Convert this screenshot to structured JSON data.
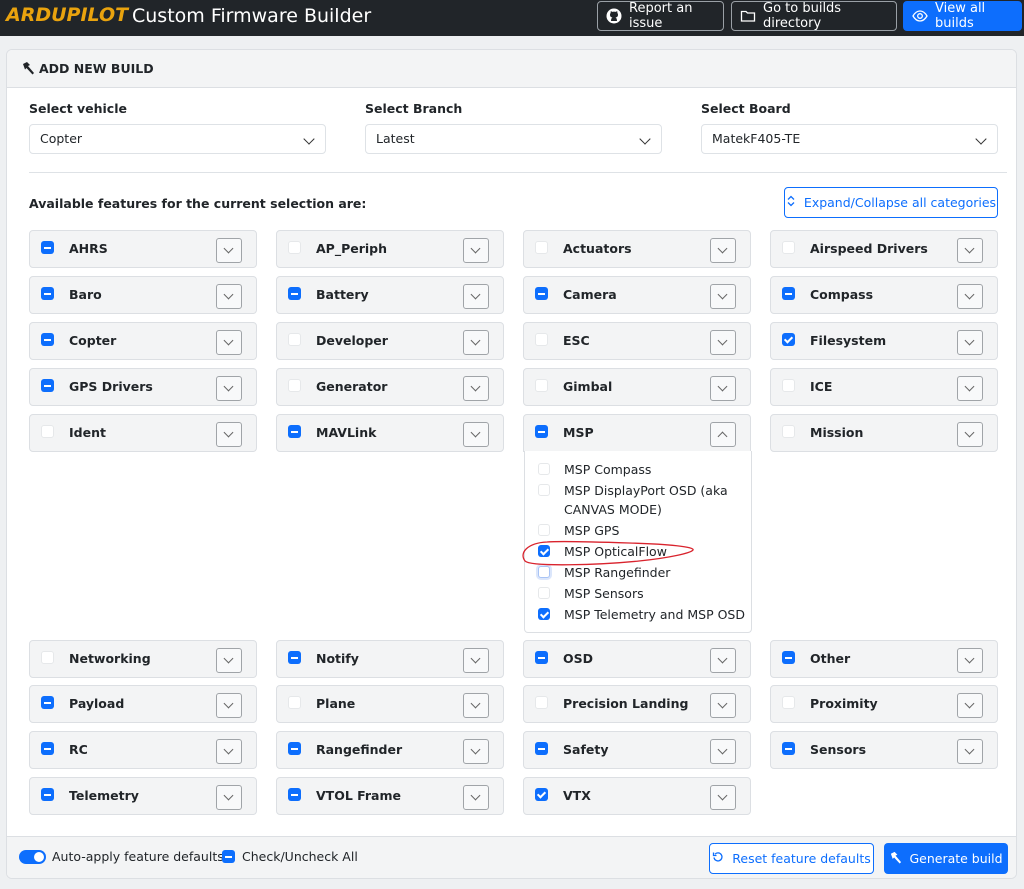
{
  "header": {
    "logo": "ARDUPILOT",
    "title": "Custom Firmware Builder",
    "buttons": {
      "report": "Report an issue",
      "builds_dir": "Go to builds directory",
      "view_all": "View all builds"
    }
  },
  "card": {
    "title": "ADD NEW BUILD",
    "vehicle": {
      "label": "Select vehicle",
      "value": "Copter"
    },
    "branch": {
      "label": "Select Branch",
      "value": "Latest"
    },
    "board": {
      "label": "Select Board",
      "value": "MatekF405-TE"
    },
    "available_text": "Available features for the current selection are:",
    "expand_label": "Expand/Collapse all categories"
  },
  "categories": [
    {
      "name": "AHRS",
      "state": "indeterminate"
    },
    {
      "name": "AP_Periph",
      "state": "off"
    },
    {
      "name": "Actuators",
      "state": "off"
    },
    {
      "name": "Airspeed Drivers",
      "state": "off"
    },
    {
      "name": "Baro",
      "state": "indeterminate"
    },
    {
      "name": "Battery",
      "state": "indeterminate"
    },
    {
      "name": "Camera",
      "state": "indeterminate"
    },
    {
      "name": "Compass",
      "state": "indeterminate"
    },
    {
      "name": "Copter",
      "state": "indeterminate"
    },
    {
      "name": "Developer",
      "state": "off"
    },
    {
      "name": "ESC",
      "state": "off"
    },
    {
      "name": "Filesystem",
      "state": "checked"
    },
    {
      "name": "GPS Drivers",
      "state": "indeterminate"
    },
    {
      "name": "Generator",
      "state": "off"
    },
    {
      "name": "Gimbal",
      "state": "off"
    },
    {
      "name": "ICE",
      "state": "off"
    },
    {
      "name": "Ident",
      "state": "off"
    },
    {
      "name": "MAVLink",
      "state": "indeterminate"
    },
    {
      "name": "MSP",
      "state": "indeterminate"
    },
    {
      "name": "Mission",
      "state": "off"
    },
    {
      "name": "Networking",
      "state": "off"
    },
    {
      "name": "Notify",
      "state": "indeterminate"
    },
    {
      "name": "OSD",
      "state": "indeterminate"
    },
    {
      "name": "Other",
      "state": "indeterminate"
    },
    {
      "name": "Payload",
      "state": "indeterminate"
    },
    {
      "name": "Plane",
      "state": "off"
    },
    {
      "name": "Precision Landing",
      "state": "off"
    },
    {
      "name": "Proximity",
      "state": "off"
    },
    {
      "name": "RC",
      "state": "indeterminate"
    },
    {
      "name": "Rangefinder",
      "state": "indeterminate"
    },
    {
      "name": "Safety",
      "state": "indeterminate"
    },
    {
      "name": "Sensors",
      "state": "indeterminate"
    },
    {
      "name": "Telemetry",
      "state": "indeterminate"
    },
    {
      "name": "VTOL Frame",
      "state": "indeterminate"
    },
    {
      "name": "VTX",
      "state": "checked"
    }
  ],
  "msp_features": [
    {
      "label": "MSP Compass",
      "checked": false
    },
    {
      "label": "MSP DisplayPort OSD (aka CANVAS MODE)",
      "checked": false
    },
    {
      "label": "MSP GPS",
      "checked": false
    },
    {
      "label": "MSP OpticalFlow",
      "checked": true
    },
    {
      "label": "MSP Rangefinder",
      "checked": false
    },
    {
      "label": "MSP Sensors",
      "checked": false
    },
    {
      "label": "MSP Telemetry and MSP OSD",
      "checked": true
    }
  ],
  "footer": {
    "auto_apply": "Auto-apply feature defaults",
    "check_all": "Check/Uncheck All",
    "reset": "Reset feature defaults",
    "generate": "Generate build"
  },
  "colors": {
    "accent": "#0d6efd",
    "logo": "#e9a30e",
    "annotation": "#d9232d"
  }
}
